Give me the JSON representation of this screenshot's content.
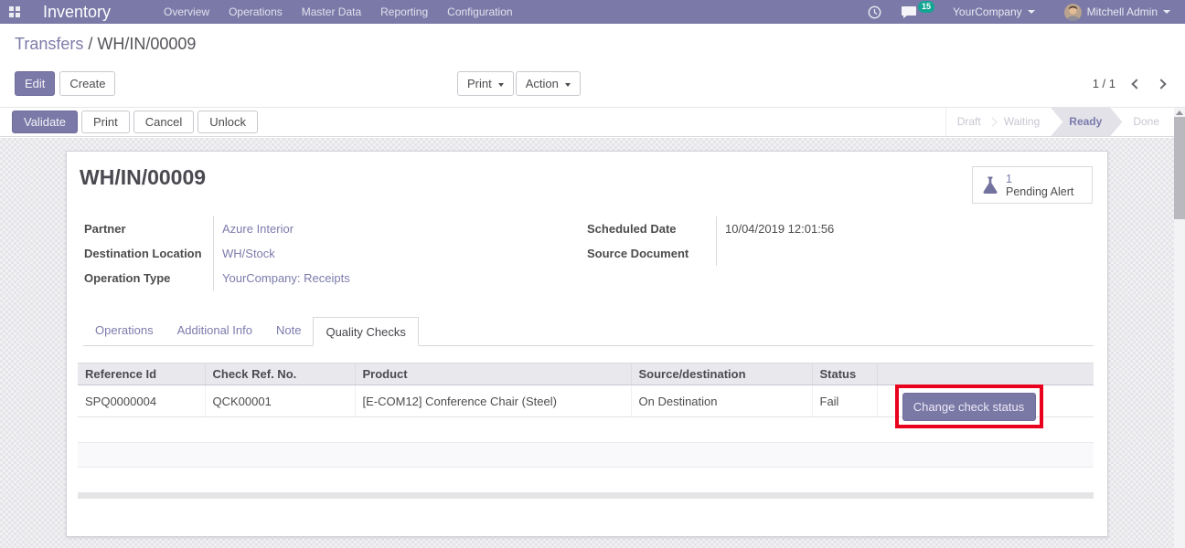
{
  "navbar": {
    "app_name": "Inventory",
    "menu_items": [
      "Overview",
      "Operations",
      "Master Data",
      "Reporting",
      "Configuration"
    ],
    "message_badge": "15",
    "company_menu": "YourCompany",
    "user_menu": "Mitchell Admin"
  },
  "control_panel": {
    "breadcrumb": {
      "parent": "Transfers",
      "separator": " / ",
      "current": "WH/IN/00009"
    },
    "buttons": {
      "edit": "Edit",
      "create": "Create",
      "print": "Print",
      "action": "Action"
    },
    "pager": {
      "value": "1 / 1"
    }
  },
  "status_bar": {
    "buttons": [
      {
        "label": "Validate",
        "primary": true
      },
      {
        "label": "Print",
        "primary": false
      },
      {
        "label": "Cancel",
        "primary": false
      },
      {
        "label": "Unlock",
        "primary": false
      }
    ],
    "pipeline": {
      "steps": [
        "Draft",
        "Waiting",
        "Ready",
        "Done"
      ],
      "active_step": "Ready"
    }
  },
  "sheet": {
    "title": "WH/IN/00009",
    "stat_button": {
      "value": "1",
      "label": "Pending Alert"
    },
    "fields_left": [
      {
        "label": "Partner",
        "value": "Azure Interior",
        "is_link": true
      },
      {
        "label": "Destination Location",
        "value": "WH/Stock",
        "is_link": true
      },
      {
        "label": "Operation Type",
        "value": "YourCompany: Receipts",
        "is_link": true
      }
    ],
    "fields_right": [
      {
        "label": "Scheduled Date",
        "value": "10/04/2019 12:01:56",
        "is_link": false
      },
      {
        "label": "Source Document",
        "value": "",
        "is_link": false
      }
    ],
    "tabs": [
      {
        "label": "Operations",
        "active": false
      },
      {
        "label": "Additional Info",
        "active": false
      },
      {
        "label": "Note",
        "active": false
      },
      {
        "label": "Quality Checks",
        "active": true
      }
    ],
    "quality_table": {
      "headers": [
        "Reference Id",
        "Check Ref. No.",
        "Product",
        "Source/destination",
        "Status",
        ""
      ],
      "rows": [
        {
          "reference_id": "SPQ0000004",
          "check_ref": "QCK00001",
          "product": "[E-COM12] Conference Chair (Steel)",
          "source_destination": "On Destination",
          "status": "Fail",
          "action_button": "Change check status"
        }
      ]
    }
  },
  "colors": {
    "brand_primary": "#7b79a7",
    "link": "#7c7bad",
    "annotation_red": "#e8001c",
    "badge_teal": "#13a593"
  }
}
